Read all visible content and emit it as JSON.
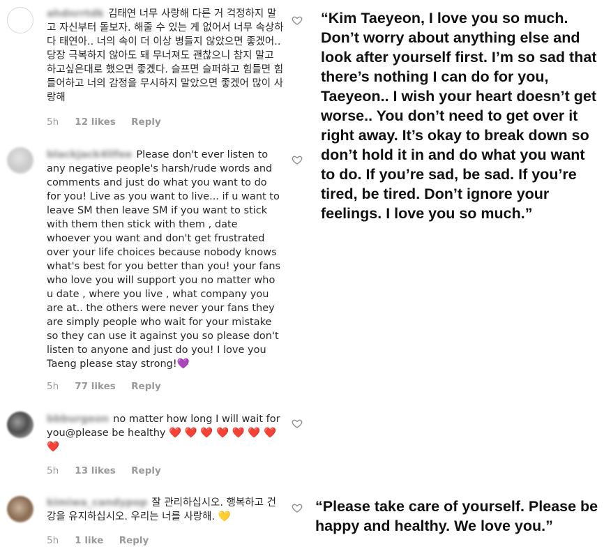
{
  "comments": [
    {
      "username": "ahdnrrtdk",
      "text": "김태연 너무 사랑해 다른 거 걱정하지 말고 자신부터 돌보자. 해줄 수 있는 게 없어서 너무 속상하다 태연아.. 너의 속이 더 이상 병들지 않았으면 좋겠어.. 당장 극복하지 않아도 돼 무너져도 괜찮으니 참지 말고 하고싶은대로 했으면 좋겠다. 슬프면 슬퍼하고 힘들면 힘들어하고 너의 감정을 무시하지 말았으면 좋겠어 많이 사랑해",
      "time": "5h",
      "likes": "12 likes",
      "reply": "Reply"
    },
    {
      "username": "blackjack4lifee",
      "text": "Please don't ever listen to any negative people's harsh/rude words and comments and just do what you want to do for you! Live as you want to live... if u want to leave SM then leave SM if you want to stick with them then stick with them , date whoever you want and don't get frustrated over your life choices because nobody knows what's best for you better than you! your fans who love you will support you no matter who u date , where you live , what company you are at.. the others were never your fans they are simply people who wait for your mistake so they can use it against you so please don't listen to anyone and just do you! I love you Taeng please stay strong!💜",
      "time": "5h",
      "likes": "77 likes",
      "reply": "Reply"
    },
    {
      "username": "bbburgeon",
      "text": "no matter how long I will wait for you@please be healthy ❤️ ❤️ ❤️ ❤️ ❤️ ❤️ ❤️ ❤️",
      "time": "5h",
      "likes": "13 likes",
      "reply": "Reply"
    },
    {
      "username": "kimiwa_candypop",
      "text": "잘 관리하십시오. 행복하고 건강을 유지하십시오. 우리는 너를 사랑해. 💛",
      "time": "5h",
      "likes": "1 like",
      "reply": "Reply"
    }
  ],
  "translations": [
    "“Kim Taeyeon, I love you so much. Don’t worry about anything else and look after yourself first. I’m so sad that there’s nothing I can do for you, Taeyeon.. I wish your heart doesn’t get worse.. You don’t need to get over it right away. It’s okay to break down so don’t hold it in and do what you want to do. If you’re sad, be sad. If you’re tired, be tired. Don’t ignore your feelings. I love you so much.”",
    "“Please take care of yourself. Please be happy and healthy. We love you.”"
  ],
  "icons": {
    "avatar": "avatar-icon",
    "like": "heart-outline-icon"
  }
}
